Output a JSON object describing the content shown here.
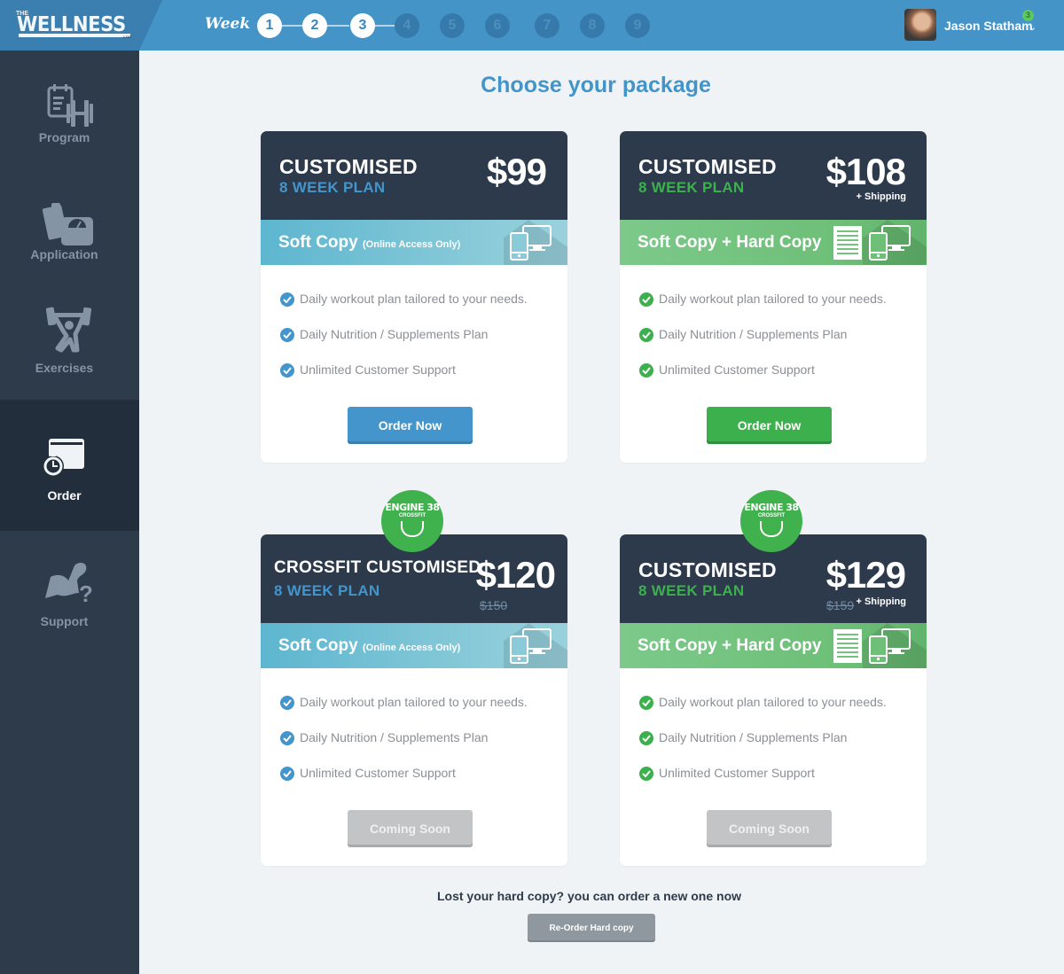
{
  "app": {
    "logo": {
      "the": "THE",
      "main": "WELLNESS",
      "log": "LOG"
    }
  },
  "header": {
    "week_label": "Week",
    "weeks": [
      {
        "n": "1",
        "state": "done"
      },
      {
        "n": "2",
        "state": "done"
      },
      {
        "n": "3",
        "state": "current"
      },
      {
        "n": "4",
        "state": "todo"
      },
      {
        "n": "5",
        "state": "todo"
      },
      {
        "n": "6",
        "state": "todo"
      },
      {
        "n": "7",
        "state": "todo"
      },
      {
        "n": "8",
        "state": "todo"
      },
      {
        "n": "9",
        "state": "todo"
      }
    ],
    "current_week": 3,
    "user_name": "Jason Statham",
    "notification_count": "3"
  },
  "sidebar": {
    "items": [
      {
        "label": "Program",
        "icon": "program-icon",
        "active": false
      },
      {
        "label": "Application",
        "icon": "application-icon",
        "active": false
      },
      {
        "label": "Exercises",
        "icon": "exercises-icon",
        "active": false
      },
      {
        "label": "Order",
        "icon": "order-icon",
        "active": true
      },
      {
        "label": "Support",
        "icon": "support-icon",
        "active": false
      }
    ]
  },
  "main": {
    "title": "Choose your package",
    "packages": [
      {
        "title": "CUSTOMISED",
        "subtitle": "8 WEEK PLAN",
        "price": "$99",
        "old_price": null,
        "shipping": null,
        "badge": null,
        "band_label": "Soft Copy",
        "band_note": "(Online Access Only)",
        "band_color": "blue",
        "features": [
          "Daily workout plan tailored to your needs.",
          "Daily Nutrition / Supplements Plan",
          "Unlimited Customer Support"
        ],
        "button": "Order Now",
        "button_style": "blue"
      },
      {
        "title": "CUSTOMISED",
        "subtitle": "8 WEEK PLAN",
        "price": "$108",
        "old_price": null,
        "shipping": "+ Shipping",
        "badge": null,
        "band_label": "Soft Copy + Hard Copy",
        "band_note": "",
        "band_color": "green",
        "features": [
          "Daily workout plan tailored to your needs.",
          "Daily Nutrition / Supplements Plan",
          "Unlimited Customer Support"
        ],
        "button": "Order Now",
        "button_style": "green"
      },
      {
        "title": "CROSSFIT CUSTOMISED",
        "subtitle": "8 WEEK PLAN",
        "price": "$120",
        "old_price": "$150",
        "shipping": null,
        "badge": {
          "line1": "ENGINE 38",
          "line2": "CROSSFIT"
        },
        "band_label": "Soft Copy",
        "band_note": "(Online Access Only)",
        "band_color": "blue",
        "features": [
          "Daily workout plan tailored to your needs.",
          "Daily Nutrition / Supplements Plan",
          "Unlimited Customer Support"
        ],
        "button": "Coming Soon",
        "button_style": "grey"
      },
      {
        "title": "CUSTOMISED",
        "subtitle": "8 WEEK PLAN",
        "price": "$129",
        "old_price": "$159",
        "shipping": "+ Shipping",
        "badge": {
          "line1": "ENGINE 38",
          "line2": "CROSSFIT"
        },
        "band_label": "Soft Copy + Hard Copy",
        "band_note": "",
        "band_color": "green",
        "features": [
          "Daily workout plan tailored to your needs.",
          "Daily Nutrition / Supplements Plan",
          "Unlimited Customer Support"
        ],
        "button": "Coming Soon",
        "button_style": "grey"
      }
    ],
    "lost_text": "Lost your hard copy? you can order a new one now",
    "reorder_button": "Re-Order Hard copy"
  },
  "colors": {
    "header_blue": "#4494c8",
    "sidebar": "#2d3b4b",
    "sidebar_active": "#222e3c",
    "accent_blue": "#4395cb",
    "accent_green": "#3db04e",
    "card_head": "#2c3a4b",
    "coming_soon_grey": "#c3c4c5"
  }
}
